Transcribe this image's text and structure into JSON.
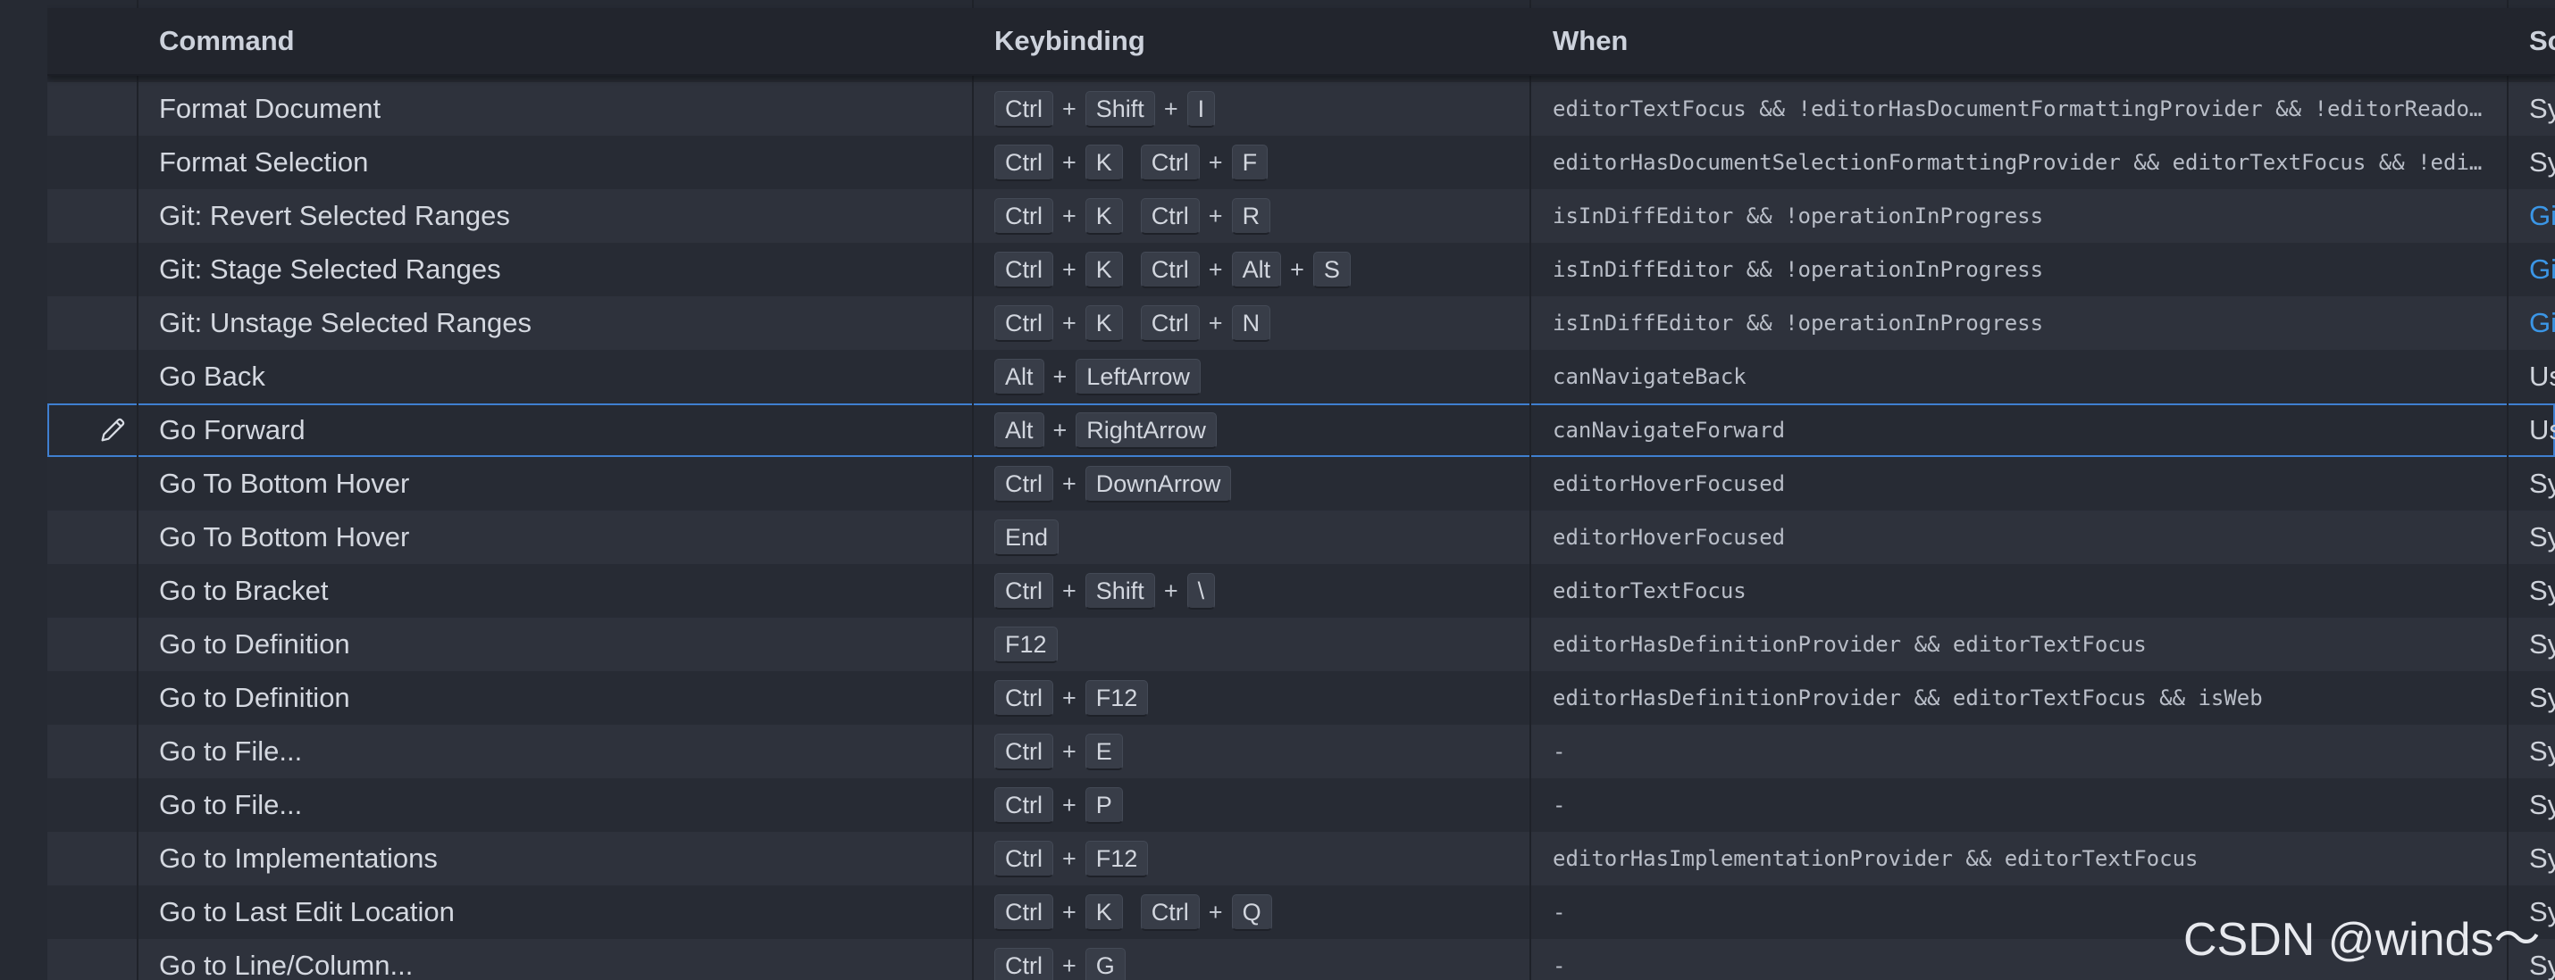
{
  "columns": {
    "command": "Command",
    "keybinding": "Keybinding",
    "when": "When",
    "source": "So"
  },
  "rows": [
    {
      "command": "Format Document",
      "chords": [
        [
          "Ctrl",
          "Shift",
          "I"
        ]
      ],
      "when": "editorTextFocus && !editorHasDocumentFormattingProvider && !editorReado…",
      "source": "Sy"
    },
    {
      "command": "Format Selection",
      "chords": [
        [
          "Ctrl",
          "K"
        ],
        [
          "Ctrl",
          "F"
        ]
      ],
      "when": "editorHasDocumentSelectionFormattingProvider && editorTextFocus && !edi…",
      "source": "Sy"
    },
    {
      "command": "Git: Revert Selected Ranges",
      "chords": [
        [
          "Ctrl",
          "K"
        ],
        [
          "Ctrl",
          "R"
        ]
      ],
      "when": "isInDiffEditor && !operationInProgress",
      "source": "Gi"
    },
    {
      "command": "Git: Stage Selected Ranges",
      "chords": [
        [
          "Ctrl",
          "K"
        ],
        [
          "Ctrl",
          "Alt",
          "S"
        ]
      ],
      "when": "isInDiffEditor && !operationInProgress",
      "source": "Gi"
    },
    {
      "command": "Git: Unstage Selected Ranges",
      "chords": [
        [
          "Ctrl",
          "K"
        ],
        [
          "Ctrl",
          "N"
        ]
      ],
      "when": "isInDiffEditor && !operationInProgress",
      "source": "Gi"
    },
    {
      "command": "Go Back",
      "chords": [
        [
          "Alt",
          "LeftArrow"
        ]
      ],
      "when": "canNavigateBack",
      "source": "Us"
    },
    {
      "command": "Go Forward",
      "chords": [
        [
          "Alt",
          "RightArrow"
        ]
      ],
      "when": "canNavigateForward",
      "source": "Us",
      "selected": true
    },
    {
      "command": "Go To Bottom Hover",
      "chords": [
        [
          "Ctrl",
          "DownArrow"
        ]
      ],
      "when": "editorHoverFocused",
      "source": "Sy"
    },
    {
      "command": "Go To Bottom Hover",
      "chords": [
        [
          "End"
        ]
      ],
      "when": "editorHoverFocused",
      "source": "Sy"
    },
    {
      "command": "Go to Bracket",
      "chords": [
        [
          "Ctrl",
          "Shift",
          "\\"
        ]
      ],
      "when": "editorTextFocus",
      "source": "Sy"
    },
    {
      "command": "Go to Definition",
      "chords": [
        [
          "F12"
        ]
      ],
      "when": "editorHasDefinitionProvider && editorTextFocus",
      "source": "Sy"
    },
    {
      "command": "Go to Definition",
      "chords": [
        [
          "Ctrl",
          "F12"
        ]
      ],
      "when": "editorHasDefinitionProvider && editorTextFocus && isWeb",
      "source": "Sy"
    },
    {
      "command": "Go to File...",
      "chords": [
        [
          "Ctrl",
          "E"
        ]
      ],
      "when": "-",
      "source": "Sy"
    },
    {
      "command": "Go to File...",
      "chords": [
        [
          "Ctrl",
          "P"
        ]
      ],
      "when": "-",
      "source": "Sy"
    },
    {
      "command": "Go to Implementations",
      "chords": [
        [
          "Ctrl",
          "F12"
        ]
      ],
      "when": "editorHasImplementationProvider && editorTextFocus",
      "source": "Sy"
    },
    {
      "command": "Go to Last Edit Location",
      "chords": [
        [
          "Ctrl",
          "K"
        ],
        [
          "Ctrl",
          "Q"
        ]
      ],
      "when": "-",
      "source": "Sy"
    },
    {
      "command": "Go to Line/Column...",
      "chords": [
        [
          "Ctrl",
          "G"
        ]
      ],
      "when": "-",
      "source": "Sy"
    }
  ],
  "watermark": "CSDN @winds～",
  "icons": {
    "edit": "pencil-icon"
  },
  "colors": {
    "selection_border": "#3f7fd0",
    "source_link": "#3b96e6"
  }
}
